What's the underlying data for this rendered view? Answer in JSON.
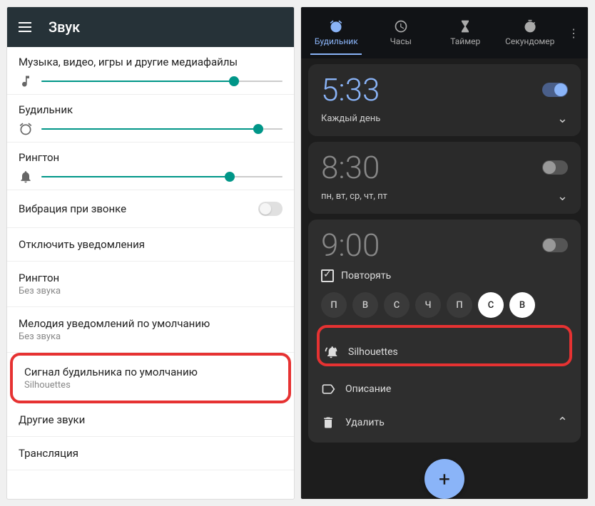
{
  "left": {
    "title": "Звук",
    "sliders": {
      "media": {
        "label": "Музыка, видео, игры и другие медиафайлы",
        "value": 80
      },
      "alarm": {
        "label": "Будильник",
        "value": 90
      },
      "ringtone": {
        "label": "Рингтон",
        "value": 78
      }
    },
    "vibrate": {
      "label": "Вибрация при звонке"
    },
    "dnd": {
      "label": "Отключить уведомления"
    },
    "ringtonePref": {
      "label": "Рингтон",
      "sub": "Без звука"
    },
    "notifSound": {
      "label": "Мелодия уведомлений по умолчанию",
      "sub": "Без звука"
    },
    "alarmSound": {
      "label": "Сигнал будильника по умолчанию",
      "sub": "Silhouettes"
    },
    "otherSounds": {
      "label": "Другие звуки"
    },
    "cast": {
      "label": "Трансляция"
    }
  },
  "right": {
    "tabs": {
      "alarm": "Будильник",
      "clock": "Часы",
      "timer": "Таймер",
      "stopwatch": "Секундомер"
    },
    "alarms": [
      {
        "time": "5:33",
        "days": "Каждый день",
        "on": true
      },
      {
        "time": "8:30",
        "days": "пн, вт, ср, чт, пт",
        "on": false
      },
      {
        "time": "9:00",
        "on": false,
        "repeat": "Повторять",
        "dayChips": [
          "П",
          "В",
          "С",
          "Ч",
          "П",
          "С",
          "В"
        ],
        "ringtone": "Silhouettes",
        "label": "Описание",
        "delete": "Удалить"
      }
    ]
  }
}
